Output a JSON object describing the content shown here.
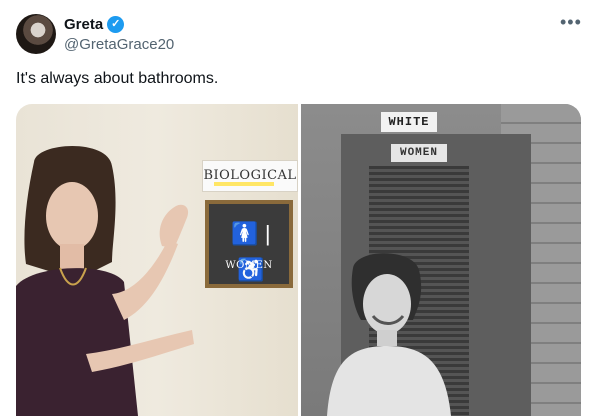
{
  "author": {
    "name": "Greta",
    "handle": "@GretaGrace20",
    "verified_mark": "✓"
  },
  "tweet": {
    "text": "It's always about bathrooms.",
    "more_icon": "•••"
  },
  "media": {
    "left_photo": {
      "label_text": "BIOLOGICAL",
      "sign_text": "WOMEN",
      "sign_icons": "🚺 | ♿"
    },
    "right_photo": {
      "top_sign_text": "WHITE",
      "door_sign_text": "WOMEN"
    }
  },
  "colors": {
    "verified": "#1d9bf0",
    "secondary_text": "#536471"
  }
}
